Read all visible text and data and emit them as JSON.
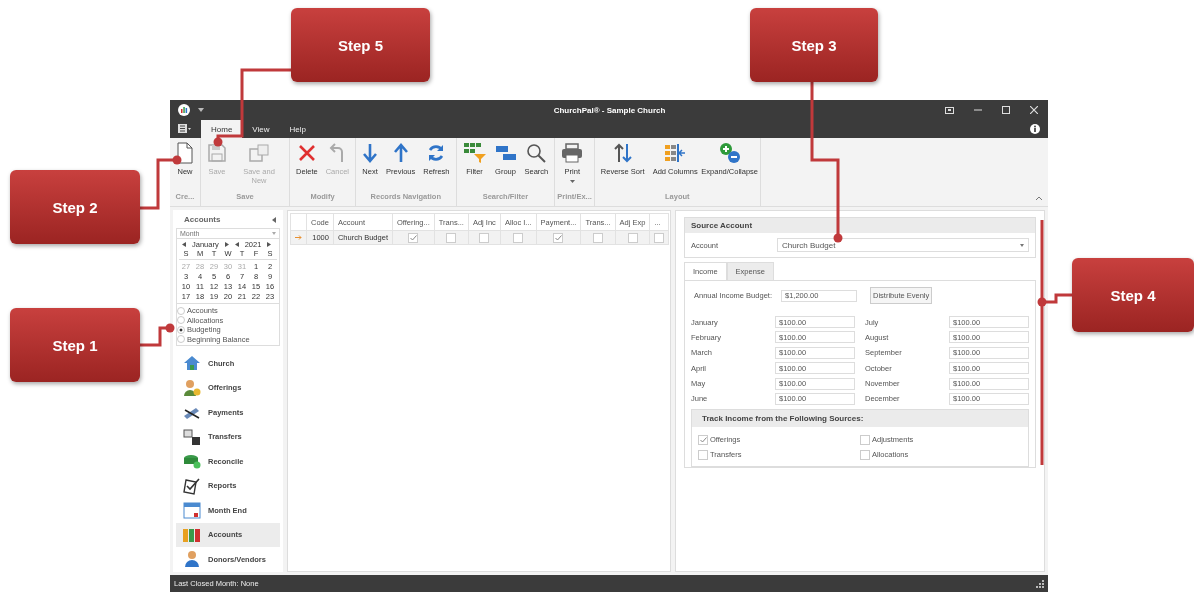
{
  "window": {
    "title": "ChurchPal® - Sample Church"
  },
  "menu_tabs": [
    {
      "label": "Home",
      "selected": true
    },
    {
      "label": "View",
      "selected": false
    },
    {
      "label": "Help",
      "selected": false
    }
  ],
  "ribbon": [
    {
      "group": "Cre...",
      "buttons": [
        {
          "label": "New",
          "disabled": false,
          "menu": false
        }
      ]
    },
    {
      "group": "Save",
      "buttons": [
        {
          "label": "Save",
          "disabled": true,
          "menu": false
        },
        {
          "label": "Save and New",
          "disabled": true,
          "menu": false
        }
      ]
    },
    {
      "group": "Modify",
      "buttons": [
        {
          "label": "Delete",
          "disabled": false,
          "menu": false
        },
        {
          "label": "Cancel",
          "disabled": true,
          "menu": false
        }
      ]
    },
    {
      "group": "Records Navigation",
      "buttons": [
        {
          "label": "Next",
          "disabled": false,
          "menu": false
        },
        {
          "label": "Previous",
          "disabled": false,
          "menu": false
        },
        {
          "label": "Refresh",
          "disabled": false,
          "menu": false
        }
      ]
    },
    {
      "group": "Search/Filter",
      "buttons": [
        {
          "label": "Filter",
          "disabled": false,
          "menu": false
        },
        {
          "label": "Group",
          "disabled": false,
          "menu": false
        },
        {
          "label": "Search",
          "disabled": false,
          "menu": false
        }
      ]
    },
    {
      "group": "Print/Ex...",
      "buttons": [
        {
          "label": "Print",
          "disabled": false,
          "menu": true
        }
      ]
    },
    {
      "group": "Layout",
      "buttons": [
        {
          "label": "Reverse Sort",
          "disabled": false,
          "menu": false
        },
        {
          "label": "Add Columns",
          "disabled": false,
          "menu": false
        },
        {
          "label": "Expand/Collapse",
          "disabled": false,
          "menu": false
        }
      ]
    }
  ],
  "sidebar": {
    "title": "Accounts",
    "filter": {
      "placeholder": "Month"
    },
    "calendar": {
      "month": "January",
      "year": "2021",
      "weekdays": [
        "S",
        "M",
        "T",
        "W",
        "T",
        "F",
        "S"
      ],
      "weeks": [
        [
          {
            "day": "27",
            "other_month": true
          },
          {
            "day": "28",
            "other_month": true
          },
          {
            "day": "29",
            "other_month": true
          },
          {
            "day": "30",
            "other_month": true
          },
          {
            "day": "31",
            "other_month": true
          },
          {
            "day": "1",
            "other_month": false
          },
          {
            "day": "2",
            "other_month": false
          }
        ],
        [
          {
            "day": "3",
            "other_month": false
          },
          {
            "day": "4",
            "other_month": false
          },
          {
            "day": "5",
            "other_month": false
          },
          {
            "day": "6",
            "other_month": false
          },
          {
            "day": "7",
            "other_month": false
          },
          {
            "day": "8",
            "other_month": false
          },
          {
            "day": "9",
            "other_month": false
          }
        ],
        [
          {
            "day": "10",
            "other_month": false
          },
          {
            "day": "11",
            "other_month": false
          },
          {
            "day": "12",
            "other_month": false
          },
          {
            "day": "13",
            "other_month": false
          },
          {
            "day": "14",
            "other_month": false
          },
          {
            "day": "15",
            "other_month": false
          },
          {
            "day": "16",
            "other_month": false
          }
        ],
        [
          {
            "day": "17",
            "other_month": false
          },
          {
            "day": "18",
            "other_month": false
          },
          {
            "day": "19",
            "other_month": false
          },
          {
            "day": "20",
            "other_month": false
          },
          {
            "day": "21",
            "other_month": false
          },
          {
            "day": "22",
            "other_month": false
          },
          {
            "day": "23",
            "other_month": false
          }
        ]
      ]
    },
    "views": [
      {
        "label": "Accounts",
        "selected": false
      },
      {
        "label": "Allocations",
        "selected": false
      },
      {
        "label": "Budgeting",
        "selected": true
      },
      {
        "label": "Beginning Balance",
        "selected": false
      }
    ],
    "nav": [
      {
        "label": "Church",
        "selected": false
      },
      {
        "label": "Offerings",
        "selected": false
      },
      {
        "label": "Payments",
        "selected": false
      },
      {
        "label": "Transfers",
        "selected": false
      },
      {
        "label": "Reconcile",
        "selected": false
      },
      {
        "label": "Reports",
        "selected": false
      },
      {
        "label": "Month End",
        "selected": false
      },
      {
        "label": "Accounts",
        "selected": true
      },
      {
        "label": "Donors/Vendors",
        "selected": false
      }
    ]
  },
  "grid": {
    "columns": [
      "Code",
      "Account",
      "Offering...",
      "Trans...",
      "Adj Inc",
      "Alloc I...",
      "Payment...",
      "Trans...",
      "Adj Exp",
      "..."
    ],
    "rows": [
      {
        "current": true,
        "code": "1000",
        "account": "Church Budget",
        "checks": [
          true,
          false,
          false,
          false,
          true,
          false,
          false,
          false
        ]
      }
    ]
  },
  "detail": {
    "source_title": "Source Account",
    "account_label": "Account",
    "account_value": "Church Budget",
    "tabs": [
      {
        "label": "Income",
        "selected": true
      },
      {
        "label": "Expense",
        "selected": false
      }
    ],
    "annual_label": "Annual Income Budget:",
    "annual_value": "$1,200.00",
    "distribute_button": "Distribute Evenly",
    "months": [
      {
        "label": "January",
        "value": "$100.00"
      },
      {
        "label": "July",
        "value": "$100.00"
      },
      {
        "label": "February",
        "value": "$100.00"
      },
      {
        "label": "August",
        "value": "$100.00"
      },
      {
        "label": "March",
        "value": "$100.00"
      },
      {
        "label": "September",
        "value": "$100.00"
      },
      {
        "label": "April",
        "value": "$100.00"
      },
      {
        "label": "October",
        "value": "$100.00"
      },
      {
        "label": "May",
        "value": "$100.00"
      },
      {
        "label": "November",
        "value": "$100.00"
      },
      {
        "label": "June",
        "value": "$100.00"
      },
      {
        "label": "December",
        "value": "$100.00"
      }
    ],
    "sources_title": "Track Income from the Following Sources:",
    "sources": [
      {
        "label": "Offerings",
        "checked": true
      },
      {
        "label": "Adjustments",
        "checked": false
      },
      {
        "label": "Transfers",
        "checked": false
      },
      {
        "label": "Allocations",
        "checked": false
      }
    ]
  },
  "status_bar": "Last Closed Month: None",
  "callouts": [
    {
      "label": "Step 5"
    },
    {
      "label": "Step 3"
    },
    {
      "label": "Step 2"
    },
    {
      "label": "Step 4"
    },
    {
      "label": "Step 1"
    }
  ]
}
